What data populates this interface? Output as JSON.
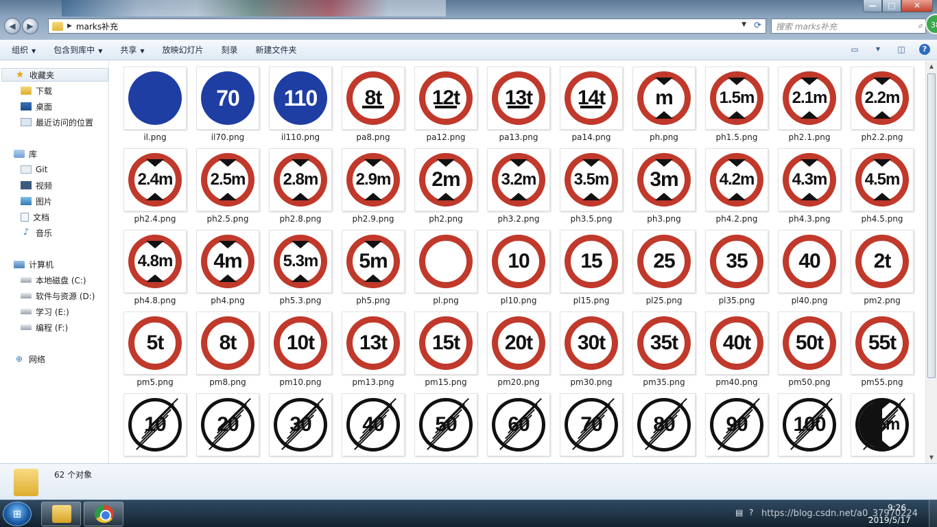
{
  "window": {
    "address_crumb": "marks补充",
    "search_placeholder": "搜索 marks补充",
    "badge": "38",
    "min_glyph": "—",
    "max_glyph": "□",
    "close_glyph": "✕"
  },
  "toolbar": {
    "organize": "组织",
    "include_library": "包含到库中",
    "share": "共享",
    "slideshow": "放映幻灯片",
    "burn": "刻录",
    "new_folder": "新建文件夹"
  },
  "sidebar": {
    "favorites": "收藏夹",
    "downloads": "下载",
    "desktop": "桌面",
    "recent": "最近访问的位置",
    "libraries": "库",
    "git": "Git",
    "videos": "视频",
    "pictures": "图片",
    "documents": "文档",
    "music": "音乐",
    "computer": "计算机",
    "drive_c": "本地磁盘 (C:)",
    "drive_d": "软件与资源 (D:)",
    "drive_e": "学习 (E:)",
    "drive_f": "编程 (F:)",
    "network": "网络"
  },
  "files": [
    {
      "name": "il.png",
      "style": "blue",
      "text": ""
    },
    {
      "name": "il70.png",
      "style": "blue",
      "text": "70"
    },
    {
      "name": "il110.png",
      "style": "blue",
      "text": "110"
    },
    {
      "name": "pa8.png",
      "style": "axle",
      "text": "8t"
    },
    {
      "name": "pa12.png",
      "style": "axle",
      "text": "12t"
    },
    {
      "name": "pa13.png",
      "style": "axle",
      "text": "13t"
    },
    {
      "name": "pa14.png",
      "style": "axle",
      "text": "14t"
    },
    {
      "name": "ph.png",
      "style": "height",
      "text": "m"
    },
    {
      "name": "ph1.5.png",
      "style": "height",
      "text": "1.5m"
    },
    {
      "name": "ph2.1.png",
      "style": "height",
      "text": "2.1m"
    },
    {
      "name": "ph2.2.png",
      "style": "height",
      "text": "2.2m"
    },
    {
      "name": "ph2.4.png",
      "style": "height",
      "text": "2.4m"
    },
    {
      "name": "ph2.5.png",
      "style": "height",
      "text": "2.5m"
    },
    {
      "name": "ph2.8.png",
      "style": "height",
      "text": "2.8m"
    },
    {
      "name": "ph2.9.png",
      "style": "height",
      "text": "2.9m"
    },
    {
      "name": "ph2.png",
      "style": "height",
      "text": "2m"
    },
    {
      "name": "ph3.2.png",
      "style": "height",
      "text": "3.2m"
    },
    {
      "name": "ph3.5.png",
      "style": "height",
      "text": "3.5m"
    },
    {
      "name": "ph3.png",
      "style": "height",
      "text": "3m"
    },
    {
      "name": "ph4.2.png",
      "style": "height",
      "text": "4.2m"
    },
    {
      "name": "ph4.3.png",
      "style": "height",
      "text": "4.3m"
    },
    {
      "name": "ph4.5.png",
      "style": "height",
      "text": "4.5m"
    },
    {
      "name": "ph4.8.png",
      "style": "height",
      "text": "4.8m"
    },
    {
      "name": "ph4.png",
      "style": "height",
      "text": "4m"
    },
    {
      "name": "ph5.3.png",
      "style": "height",
      "text": "5.3m"
    },
    {
      "name": "ph5.png",
      "style": "height",
      "text": "5m"
    },
    {
      "name": "pl.png",
      "style": "red",
      "text": ""
    },
    {
      "name": "pl10.png",
      "style": "red",
      "text": "10"
    },
    {
      "name": "pl15.png",
      "style": "red",
      "text": "15"
    },
    {
      "name": "pl25.png",
      "style": "red",
      "text": "25"
    },
    {
      "name": "pl35.png",
      "style": "red",
      "text": "35"
    },
    {
      "name": "pl40.png",
      "style": "red",
      "text": "40"
    },
    {
      "name": "pm2.png",
      "style": "red",
      "text": "2t"
    },
    {
      "name": "pm5.png",
      "style": "red",
      "text": "5t"
    },
    {
      "name": "pm8.png",
      "style": "red",
      "text": "8t"
    },
    {
      "name": "pm10.png",
      "style": "red",
      "text": "10t"
    },
    {
      "name": "pm13.png",
      "style": "red",
      "text": "13t"
    },
    {
      "name": "pm15.png",
      "style": "red",
      "text": "15t"
    },
    {
      "name": "pm20.png",
      "style": "red",
      "text": "20t"
    },
    {
      "name": "pm30.png",
      "style": "red",
      "text": "30t"
    },
    {
      "name": "pm35.png",
      "style": "red",
      "text": "35t"
    },
    {
      "name": "pm40.png",
      "style": "red",
      "text": "40t"
    },
    {
      "name": "pm50.png",
      "style": "red",
      "text": "50t"
    },
    {
      "name": "pm55.png",
      "style": "red",
      "text": "55t"
    },
    {
      "name": "",
      "style": "end",
      "text": "10"
    },
    {
      "name": "",
      "style": "end",
      "text": "20"
    },
    {
      "name": "",
      "style": "end",
      "text": "30"
    },
    {
      "name": "",
      "style": "end",
      "text": "40"
    },
    {
      "name": "",
      "style": "end",
      "text": "50"
    },
    {
      "name": "",
      "style": "end",
      "text": "60"
    },
    {
      "name": "",
      "style": "end",
      "text": "70"
    },
    {
      "name": "",
      "style": "end",
      "text": "80"
    },
    {
      "name": "",
      "style": "end",
      "text": "90"
    },
    {
      "name": "",
      "style": "end",
      "text": "100"
    },
    {
      "name": "",
      "style": "endheight",
      "text": "2.5m"
    }
  ],
  "status": {
    "count": "62 个对象"
  },
  "taskbar": {
    "start_glyph": "⊞",
    "watermark": "https://blog.csdn.net/a0_37970224",
    "time": "9:26",
    "date": "2019/5/17"
  },
  "colors": {
    "sign_red": "#c0392b",
    "sign_blue": "#1f3ea3",
    "accent": "#2d6cc0"
  }
}
